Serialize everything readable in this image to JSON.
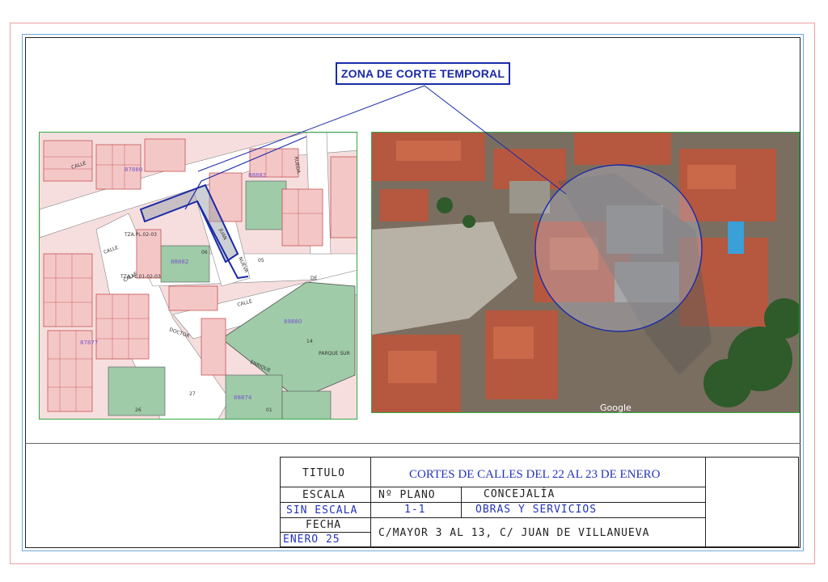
{
  "zone_label": "ZONA DE CORTE TEMPORAL",
  "cadastral_labels": {
    "street_calle_top": "CALLE",
    "street_calle_mid": "CALLE",
    "street_calle_left": "CALLE",
    "street_doctor": "DOCTOR",
    "street_de": "DE",
    "street_juan": "JUAN",
    "street_calle_vert": "CALLE",
    "street_nueva": "NUEVA",
    "street_rueda": "RUEDA",
    "street_enrique": "ENRIQUE",
    "parque": "PARQUE SUR",
    "parcel_a": "88882",
    "parcel_b": "88882",
    "parcel_c": "89880",
    "parcel_d": "87880",
    "parcel_e": "88874",
    "parcel_f": "87877",
    "num_14": "14",
    "num_06": "06",
    "num_01": "01",
    "num_05": "05",
    "num_26": "26",
    "num_27": "27",
    "plan_ref_1": "TZA.PL.02-03",
    "plan_ref_2": "TZA.PL.01-02-03"
  },
  "aerial_watermark": "Google",
  "title_block": {
    "titulo_label": "TITULO",
    "titulo_value": "CORTES DE CALLES DEL 22 AL 23 DE ENERO",
    "escala_label": "ESCALA",
    "escala_value": "SIN ESCALA",
    "plano_label": "Nº PLANO",
    "plano_value": "1-1",
    "concejalia_label": "CONCEJALÍA",
    "concejalia_value": "OBRAS Y SERVICIOS",
    "fecha_label": "FECHA",
    "fecha_value": "ENERO 25",
    "address": "C/MAYOR 3 AL 13, C/ JUAN DE VILLANUEVA"
  },
  "colors": {
    "accent_blue": "#1a2aa8",
    "frame_green": "#33aa44",
    "parcel_pink": "#f4c7c7",
    "parcel_green": "#9fcba8"
  }
}
